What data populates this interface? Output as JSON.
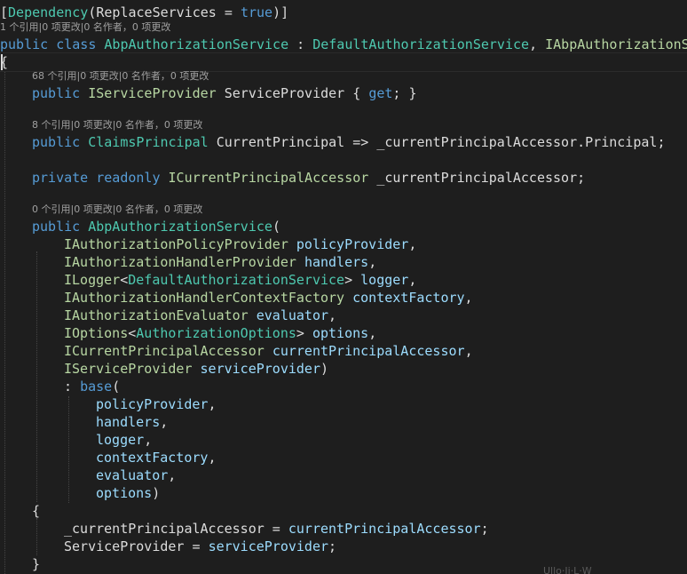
{
  "tokens": {
    "dependency": "Dependency",
    "replace_services": "ReplaceServices",
    "true_kw": "true",
    "public_kw": "public",
    "class_kw": "class",
    "private_kw": "private",
    "readonly_kw": "readonly",
    "get_kw": "get",
    "base_kw": "base",
    "class_name": "AbpAuthorizationService",
    "base_class": "DefaultAuthorizationService",
    "interface_name": "IAbpAuthorizationS",
    "iservice_provider": "IServiceProvider",
    "service_provider_prop": "ServiceProvider",
    "claims_principal": "ClaimsPrincipal",
    "current_principal": "CurrentPrincipal",
    "accessor_field": "_currentPrincipalAccessor",
    "principal_member": "Principal",
    "icurrent_principal_accessor": "ICurrentPrincipalAccessor",
    "iauthorization_policy_provider": "IAuthorizationPolicyProvider",
    "policy_provider": "policyProvider",
    "iauthorization_handler_provider": "IAuthorizationHandlerProvider",
    "handlers": "handlers",
    "ilogger": "ILogger",
    "default_authorization_service": "DefaultAuthorizationService",
    "logger": "logger",
    "iauthorization_handler_context_factory": "IAuthorizationHandlerContextFactory",
    "context_factory": "contextFactory",
    "iauthorization_evaluator": "IAuthorizationEvaluator",
    "evaluator": "evaluator",
    "ioptions": "IOptions",
    "authorization_options": "AuthorizationOptions",
    "options": "options",
    "current_principal_accessor_param": "currentPrincipalAccessor",
    "service_provider_param": "serviceProvider"
  },
  "code_lens": {
    "class": "1 个引用|0 项更改|0 名作者，0 项更改",
    "service_provider": "68 个引用|0 项更改|0 名作者，0 项更改",
    "current_principal": "8 个引用|0 项更改|0 名作者，0 项更改",
    "constructor": "0 个引用|0 项更改|0 名作者，0 项更改"
  },
  "watermark": "Ullo·Ji·L·W"
}
